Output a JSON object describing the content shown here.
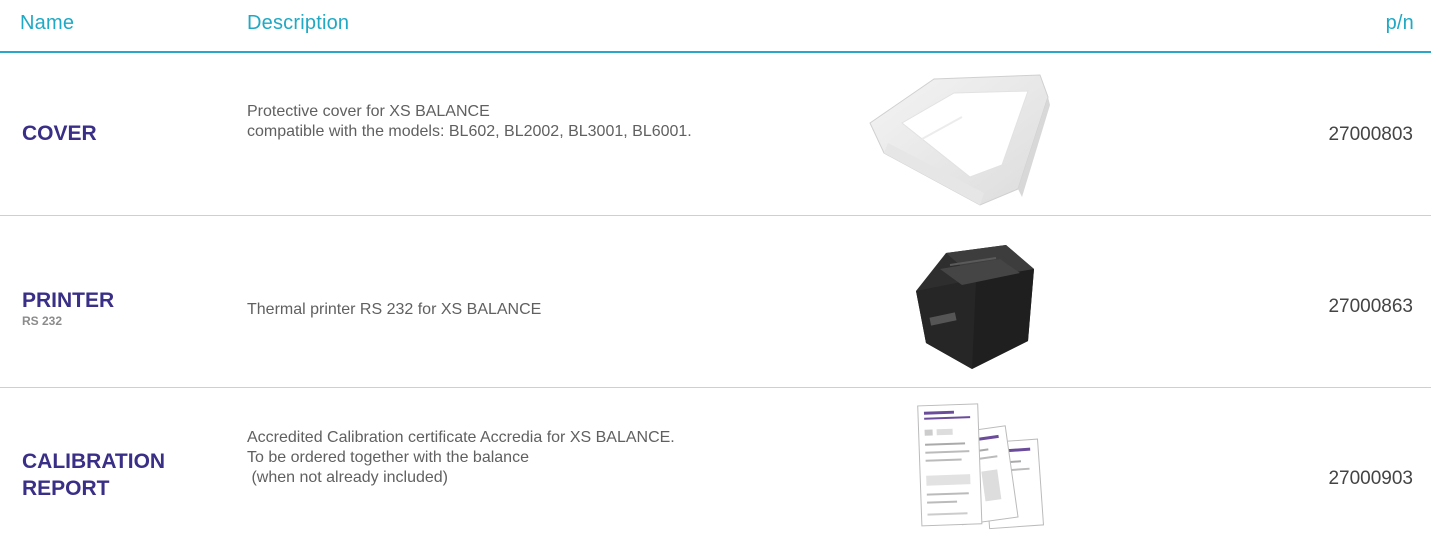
{
  "header": {
    "name": "Name",
    "description": "Description",
    "pn": "p/n"
  },
  "products": [
    {
      "name": "COVER",
      "subtitle": "",
      "description": [
        "Protective cover for XS BALANCE",
        "compatible with the models: BL602, BL2002, BL3001, BL6001."
      ],
      "pn": "27000803",
      "image": "transparent-cover-image"
    },
    {
      "name": "PRINTER",
      "subtitle": "RS 232",
      "description": [
        "Thermal printer RS 232 for XS BALANCE"
      ],
      "pn": "27000863",
      "image": "thermal-printer-image"
    },
    {
      "name_lines": [
        "CALIBRATION",
        "REPORT"
      ],
      "description": [
        "Accredited Calibration certificate Accredia for XS BALANCE.",
        "To be ordered together with the balance",
        " (when not already included)"
      ],
      "pn": "27000903",
      "image": "calibration-certificate-image"
    }
  ],
  "colors": {
    "header": "#1fa9c4",
    "name": "#3a2f86",
    "text": "#606060",
    "rule": "#2aa7c8"
  }
}
